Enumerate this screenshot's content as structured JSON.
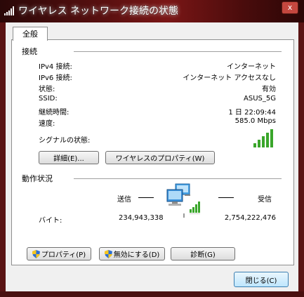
{
  "window": {
    "title": "ワイヤレス ネットワーク接続の状態",
    "close_glyph": "x"
  },
  "tabs": [
    {
      "label": "全般"
    }
  ],
  "connection": {
    "section_label": "接続",
    "rows": [
      {
        "label": "IPv4 接続:",
        "value": "インターネット"
      },
      {
        "label": "IPv6 接続:",
        "value": "インターネット アクセスなし"
      },
      {
        "label": "状態:",
        "value": "有効"
      },
      {
        "label": "SSID:",
        "value": "ASUS_5G"
      },
      {
        "label": "継続時間:",
        "value": "1 日  22:09:44"
      },
      {
        "label": "速度:",
        "value": "585.0 Mbps"
      }
    ],
    "signal_label": "シグナルの状態:",
    "signal_bars": 5,
    "signal_max": 5
  },
  "buttons": {
    "details": "詳細(E)...",
    "wireless_properties": "ワイヤレスのプロパティ(W)",
    "properties": "プロパティ(P)",
    "disable": "無効にする(D)",
    "diagnose": "診断(G)",
    "close": "閉じる(C)"
  },
  "activity": {
    "section_label": "動作状況",
    "sent_label": "送信",
    "received_label": "受信",
    "bytes_label": "バイト:",
    "sent_bytes": "234,943,338",
    "received_bytes": "2,754,222,476"
  },
  "colors": {
    "signal_green": "#3aa62b",
    "accent_blue": "#3c7fb1"
  }
}
